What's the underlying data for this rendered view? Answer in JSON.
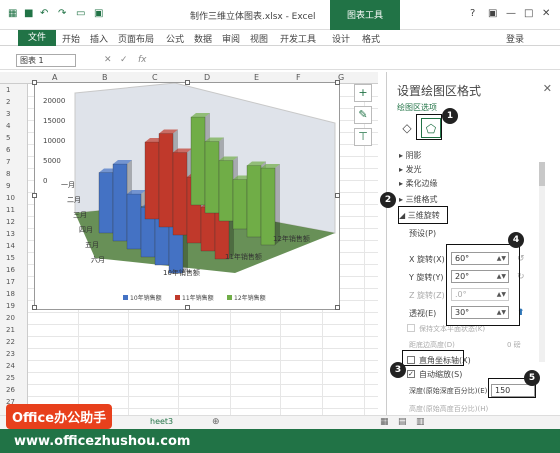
{
  "window": {
    "title": "制作三维立体图表.xlsx - Excel",
    "context_tab": "图表工具",
    "login": "登录"
  },
  "ribbon": {
    "tabs": [
      "文件",
      "开始",
      "插入",
      "页面布局",
      "公式",
      "数据",
      "审阅",
      "视图",
      "开发工具",
      "设计",
      "格式"
    ]
  },
  "formula_bar": {
    "name_box": "图表 1",
    "fx": "fx"
  },
  "sheet": {
    "columns": [
      "A",
      "B",
      "C",
      "D",
      "E",
      "F",
      "G"
    ],
    "rows": [
      "1",
      "2",
      "3",
      "4",
      "5",
      "6",
      "7",
      "8",
      "9",
      "10",
      "11",
      "12",
      "13",
      "14",
      "15",
      "16",
      "17",
      "18",
      "19",
      "20",
      "21",
      "22",
      "23",
      "24",
      "25",
      "26",
      "27"
    ],
    "tab_partial": "heet3"
  },
  "chart_data": {
    "type": "bar",
    "categories": [
      "一月",
      "二月",
      "三月",
      "四月",
      "五月",
      "六月"
    ],
    "series": [
      {
        "name": "10年销售额",
        "values": [
          11000,
          14000,
          10000,
          9000,
          13000,
          11000
        ],
        "color": "#4472c4"
      },
      {
        "name": "11年销售额",
        "values": [
          14000,
          17000,
          15000,
          12000,
          8000,
          13000
        ],
        "color": "#c0392b"
      },
      {
        "name": "12年销售额",
        "values": [
          16000,
          13000,
          11000,
          9000,
          13000,
          14000
        ],
        "color": "#70ad47"
      }
    ],
    "y_ticks": [
      "20000",
      "15000",
      "10000",
      "5000",
      "0"
    ],
    "ylim": [
      0,
      20000
    ],
    "series_axis_labels": [
      "12年销售额",
      "11年销售额",
      "10年销售额"
    ]
  },
  "pane": {
    "title": "设置绘图区格式",
    "options_label": "绘图区选项",
    "sections": [
      "阴影",
      "发光",
      "柔化边缘",
      "三维格式",
      "三维旋转"
    ],
    "preset_label": "预设(P)",
    "x_rotation_label": "X 旋转(X)",
    "x_rotation": "60°",
    "y_rotation_label": "Y 旋转(Y)",
    "y_rotation": "20°",
    "z_rotation_label": "Z 旋转(Z)",
    "z_rotation": ".0°",
    "perspective_label": "透视(E)",
    "perspective": "30°",
    "keep_text_flat": "保持文本平面状态(K)",
    "distance_label": "距底边高度(D)",
    "distance": "0 磅",
    "right_angle_axes": "直角坐标轴(X)",
    "autoscale": "自动缩放(S)",
    "depth_label": "深度(原始深度百分比)(E)",
    "depth": "150",
    "height_label": "高度(原始高度百分比)(H)"
  },
  "annotations": [
    "1",
    "2",
    "3",
    "4",
    "5"
  ],
  "watermark": {
    "brand": "Office办公助手",
    "url": "www.officezhushou.com"
  }
}
